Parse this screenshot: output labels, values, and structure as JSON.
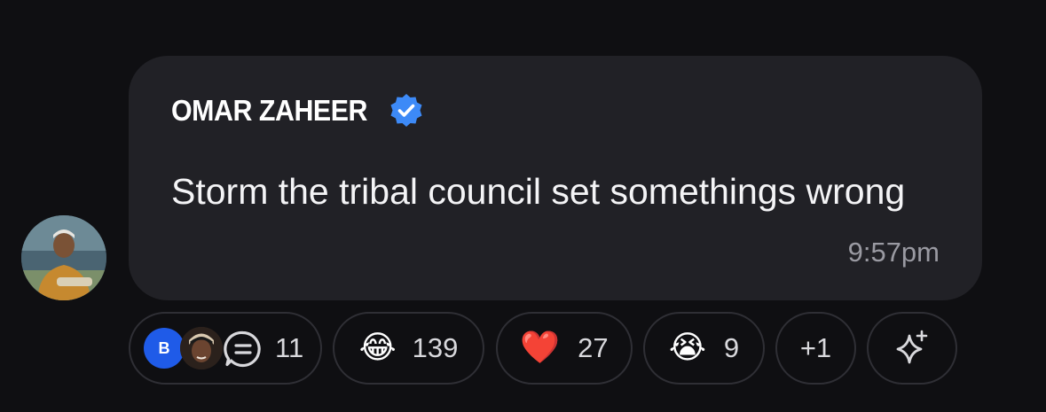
{
  "message": {
    "sender": "OMAR ZAHEER",
    "verified": true,
    "text": "Storm the tribal council set somethings wrong",
    "time": "9:57pm"
  },
  "reply_thread": {
    "avatar_initial": "B",
    "count": "11"
  },
  "reactions": [
    {
      "emoji": "😂",
      "icon": "face-with-tears-of-joy-icon",
      "count": "139"
    },
    {
      "emoji": "❤️",
      "icon": "red-heart-icon",
      "count": "27"
    },
    {
      "emoji": "😭",
      "icon": "loudly-crying-face-icon",
      "count": "9"
    }
  ],
  "more_reactions": "+1",
  "colors": {
    "background": "#0f0f12",
    "bubble": "#212126",
    "verified_blue": "#3d8af7",
    "reply_avatar_blue": "#1f5be8",
    "timestamp": "#9a9aa2"
  }
}
